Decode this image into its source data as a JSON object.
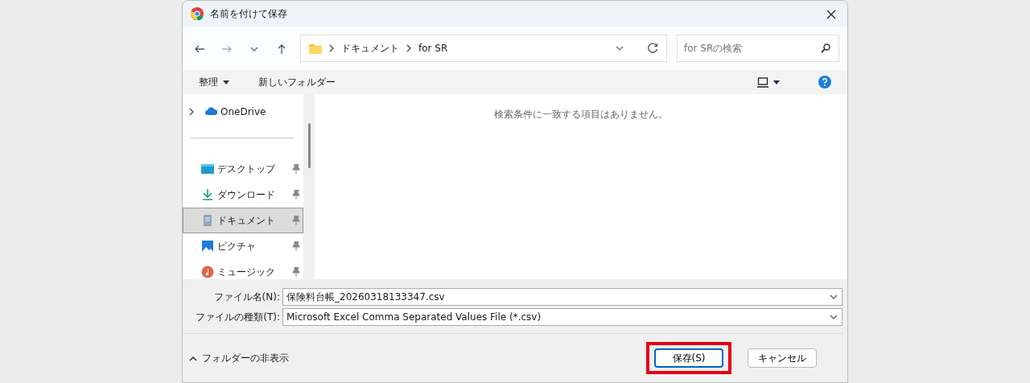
{
  "window": {
    "title": "名前を付けて保存"
  },
  "breadcrumb": [
    "ドキュメント",
    "for SR"
  ],
  "search": {
    "placeholder": "for SRの検索"
  },
  "toolbar": {
    "organize": "整理",
    "new_folder": "新しいフォルダー"
  },
  "sidebar": {
    "items": [
      {
        "label": "OneDrive",
        "kind": "cloud",
        "selected": false
      },
      {
        "label": "デスクトップ",
        "kind": "desktop",
        "selected": false
      },
      {
        "label": "ダウンロード",
        "kind": "download",
        "selected": false
      },
      {
        "label": "ドキュメント",
        "kind": "document",
        "selected": true
      },
      {
        "label": "ピクチャ",
        "kind": "picture",
        "selected": false
      },
      {
        "label": "ミュージック",
        "kind": "music",
        "selected": false
      }
    ]
  },
  "empty_message": "検索条件に一致する項目はありません。",
  "fields": [
    {
      "label": "ファイル名(N):",
      "value": "保険料台帳_20260318133347.csv"
    },
    {
      "label": "ファイルの種類(T):",
      "value": "Microsoft Excel Comma Separated Values File (*.csv)"
    }
  ],
  "hide_folders": "フォルダーの非表示",
  "buttons": [
    {
      "label": "保存(S)",
      "highlighted": true
    },
    {
      "label": "キャンセル",
      "highlighted": false
    }
  ]
}
